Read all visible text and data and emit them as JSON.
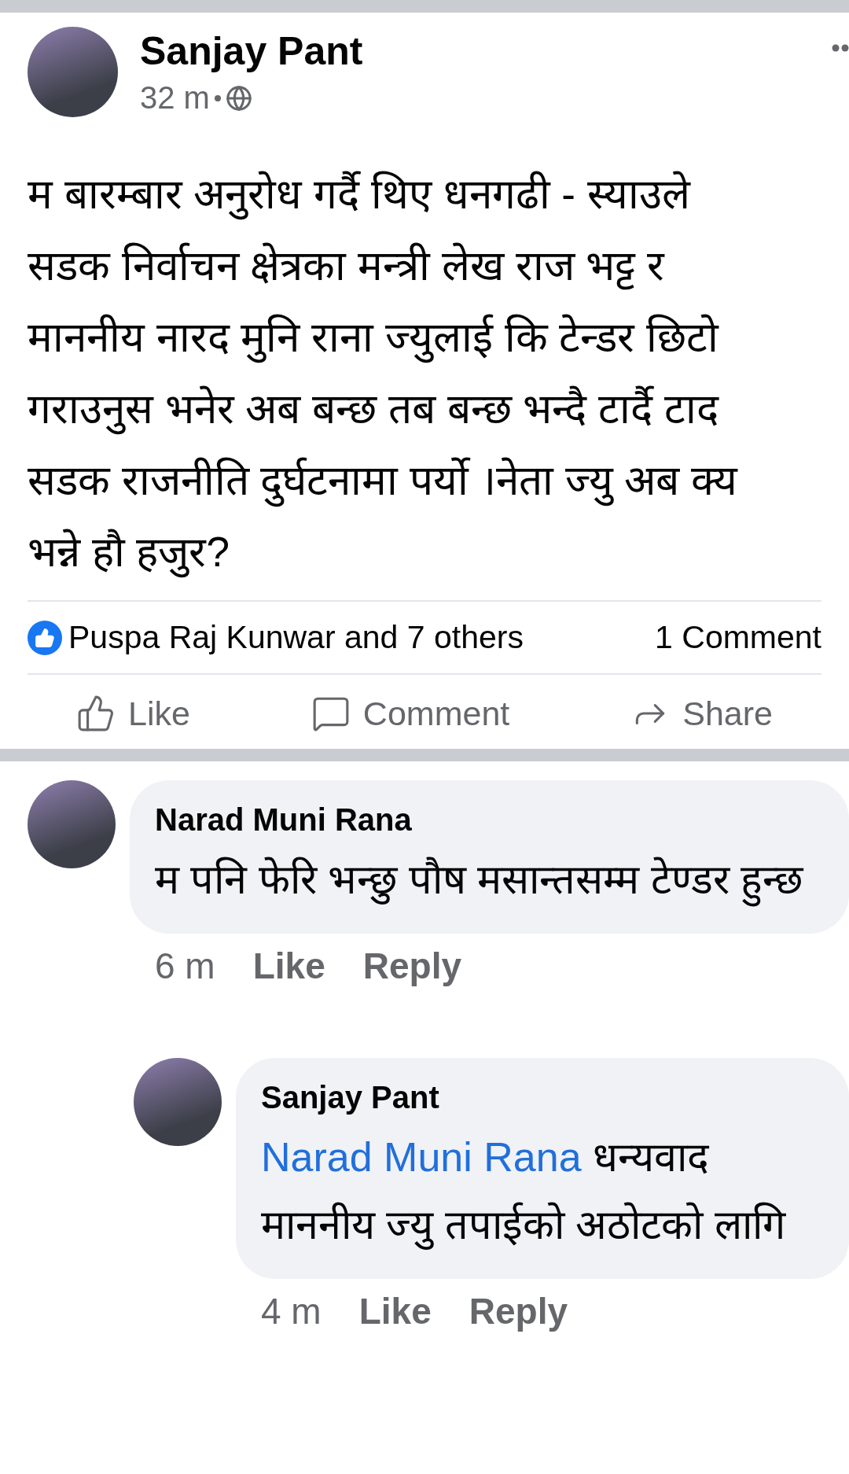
{
  "post": {
    "author": "Sanjay Pant",
    "time": "32 m",
    "text_lines": [
      "म बारम्बार अनुरोध गर्दै थिए धनगढी - स्याउले",
      "सडक निर्वाचन क्षेत्रका मन्त्री लेख राज भट्ट र",
      "माननीय नारद मुनि राना ज्युलाई कि टेन्डर छिटो",
      "गराउनुस भनेर अब बन्छ तब बन्छ भन्दै टार्दै टाद",
      "सडक राजनीति दुर्घटनामा पर्यो ।नेता ज्यु अब क्य",
      "भन्ने हौ हजुर?"
    ],
    "reactions": "Puspa Raj Kunwar and 7 others",
    "comment_count": "1 Comment",
    "actions": [
      {
        "kind": "like",
        "label": "Like"
      },
      {
        "kind": "comment",
        "label": "Comment"
      },
      {
        "kind": "share",
        "label": "Share"
      }
    ]
  },
  "comments": [
    {
      "author": "Narad Muni Rana",
      "text": "म पनि फेरि भन्छु पौष मसान्तसम्म टेण्डर हुन्छ",
      "time": "6 m",
      "like": "Like",
      "reply": "Reply",
      "children": [
        {
          "author": "Sanjay Pant",
          "mention": "Narad Muni Rana",
          "text": "धन्यवाद माननीय ज्यु तपाईको अठोटको लागि",
          "time": "4 m",
          "like": "Like",
          "reply": "Reply"
        }
      ]
    }
  ]
}
